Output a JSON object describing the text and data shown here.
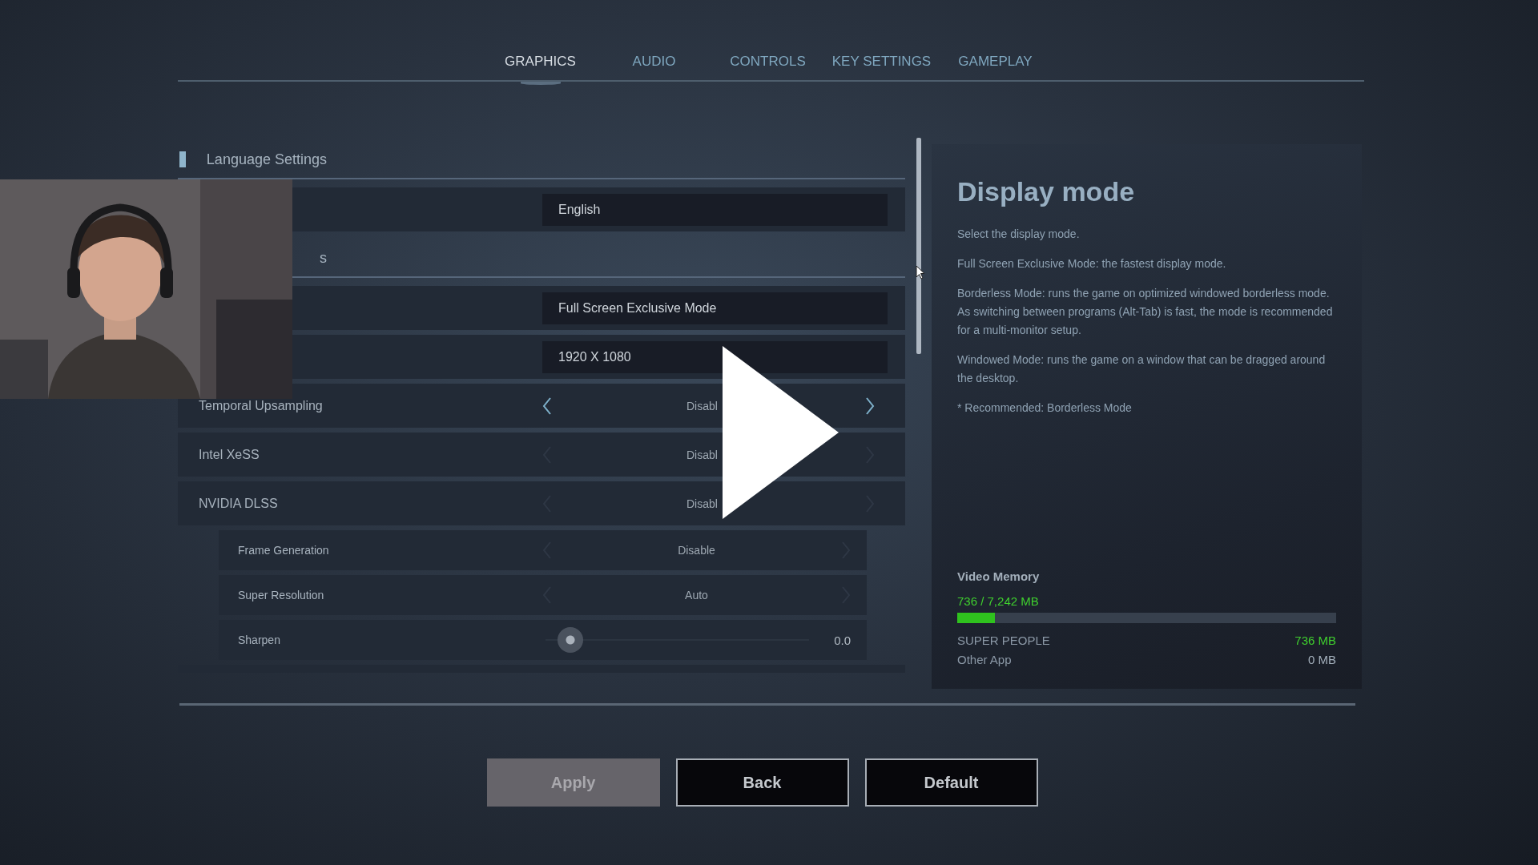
{
  "tabs": [
    {
      "label": "GRAPHICS",
      "selected": true
    },
    {
      "label": "AUDIO",
      "selected": false
    },
    {
      "label": "CONTROLS",
      "selected": false
    },
    {
      "label": "KEY SETTINGS",
      "selected": false
    },
    {
      "label": "GAMEPLAY",
      "selected": false
    }
  ],
  "sections": [
    {
      "title": "Language Settings",
      "rows": [
        {
          "kind": "dropdown",
          "value": "English"
        }
      ]
    },
    {
      "title": "s",
      "rows": [
        {
          "kind": "dropdown",
          "value": "Full Screen Exclusive Mode"
        },
        {
          "kind": "dropdown",
          "value": "1920 X 1080"
        },
        {
          "kind": "selector",
          "label": "Temporal Upsampling",
          "value": "Disabl",
          "enabled": true
        },
        {
          "kind": "selector",
          "label": "Intel XeSS",
          "value": "Disabl",
          "enabled": false
        },
        {
          "kind": "selector",
          "label": "NVIDIA DLSS",
          "value": "Disabl",
          "enabled": false,
          "children": [
            {
              "kind": "selector",
              "label": "Frame Generation",
              "value": "Disable",
              "enabled": false
            },
            {
              "kind": "selector",
              "label": "Super Resolution",
              "value": "Auto",
              "enabled": false
            },
            {
              "kind": "slider",
              "label": "Sharpen",
              "value": "0.0",
              "level": 0.05
            }
          ]
        }
      ]
    }
  ],
  "info": {
    "title": "Display mode",
    "paragraphs": [
      "Select the display mode.",
      "Full Screen Exclusive Mode: the fastest display mode.",
      "Borderless Mode: runs the game on optimized windowed borderless mode. As switching between programs (Alt-Tab) is fast, the mode is recommended for a multi-monitor setup.",
      "Windowed Mode: runs the game on a window that can be dragged around the desktop.",
      "* Recommended: Borderless Mode"
    ]
  },
  "video_memory": {
    "title": "Video Memory",
    "usage": "736 / 7,242 MB",
    "level": 0.1,
    "items": [
      {
        "name": "SUPER PEOPLE",
        "value": "736 MB",
        "color": "#3fcf2e"
      },
      {
        "name": "Other App",
        "value": "0 MB",
        "color": "#a3afbb"
      }
    ]
  },
  "buttons": [
    {
      "label": "Apply",
      "disabled": true
    },
    {
      "label": "Back",
      "disabled": false
    },
    {
      "label": "Default",
      "disabled": false
    }
  ],
  "video_overlay": {
    "kind": "play"
  }
}
